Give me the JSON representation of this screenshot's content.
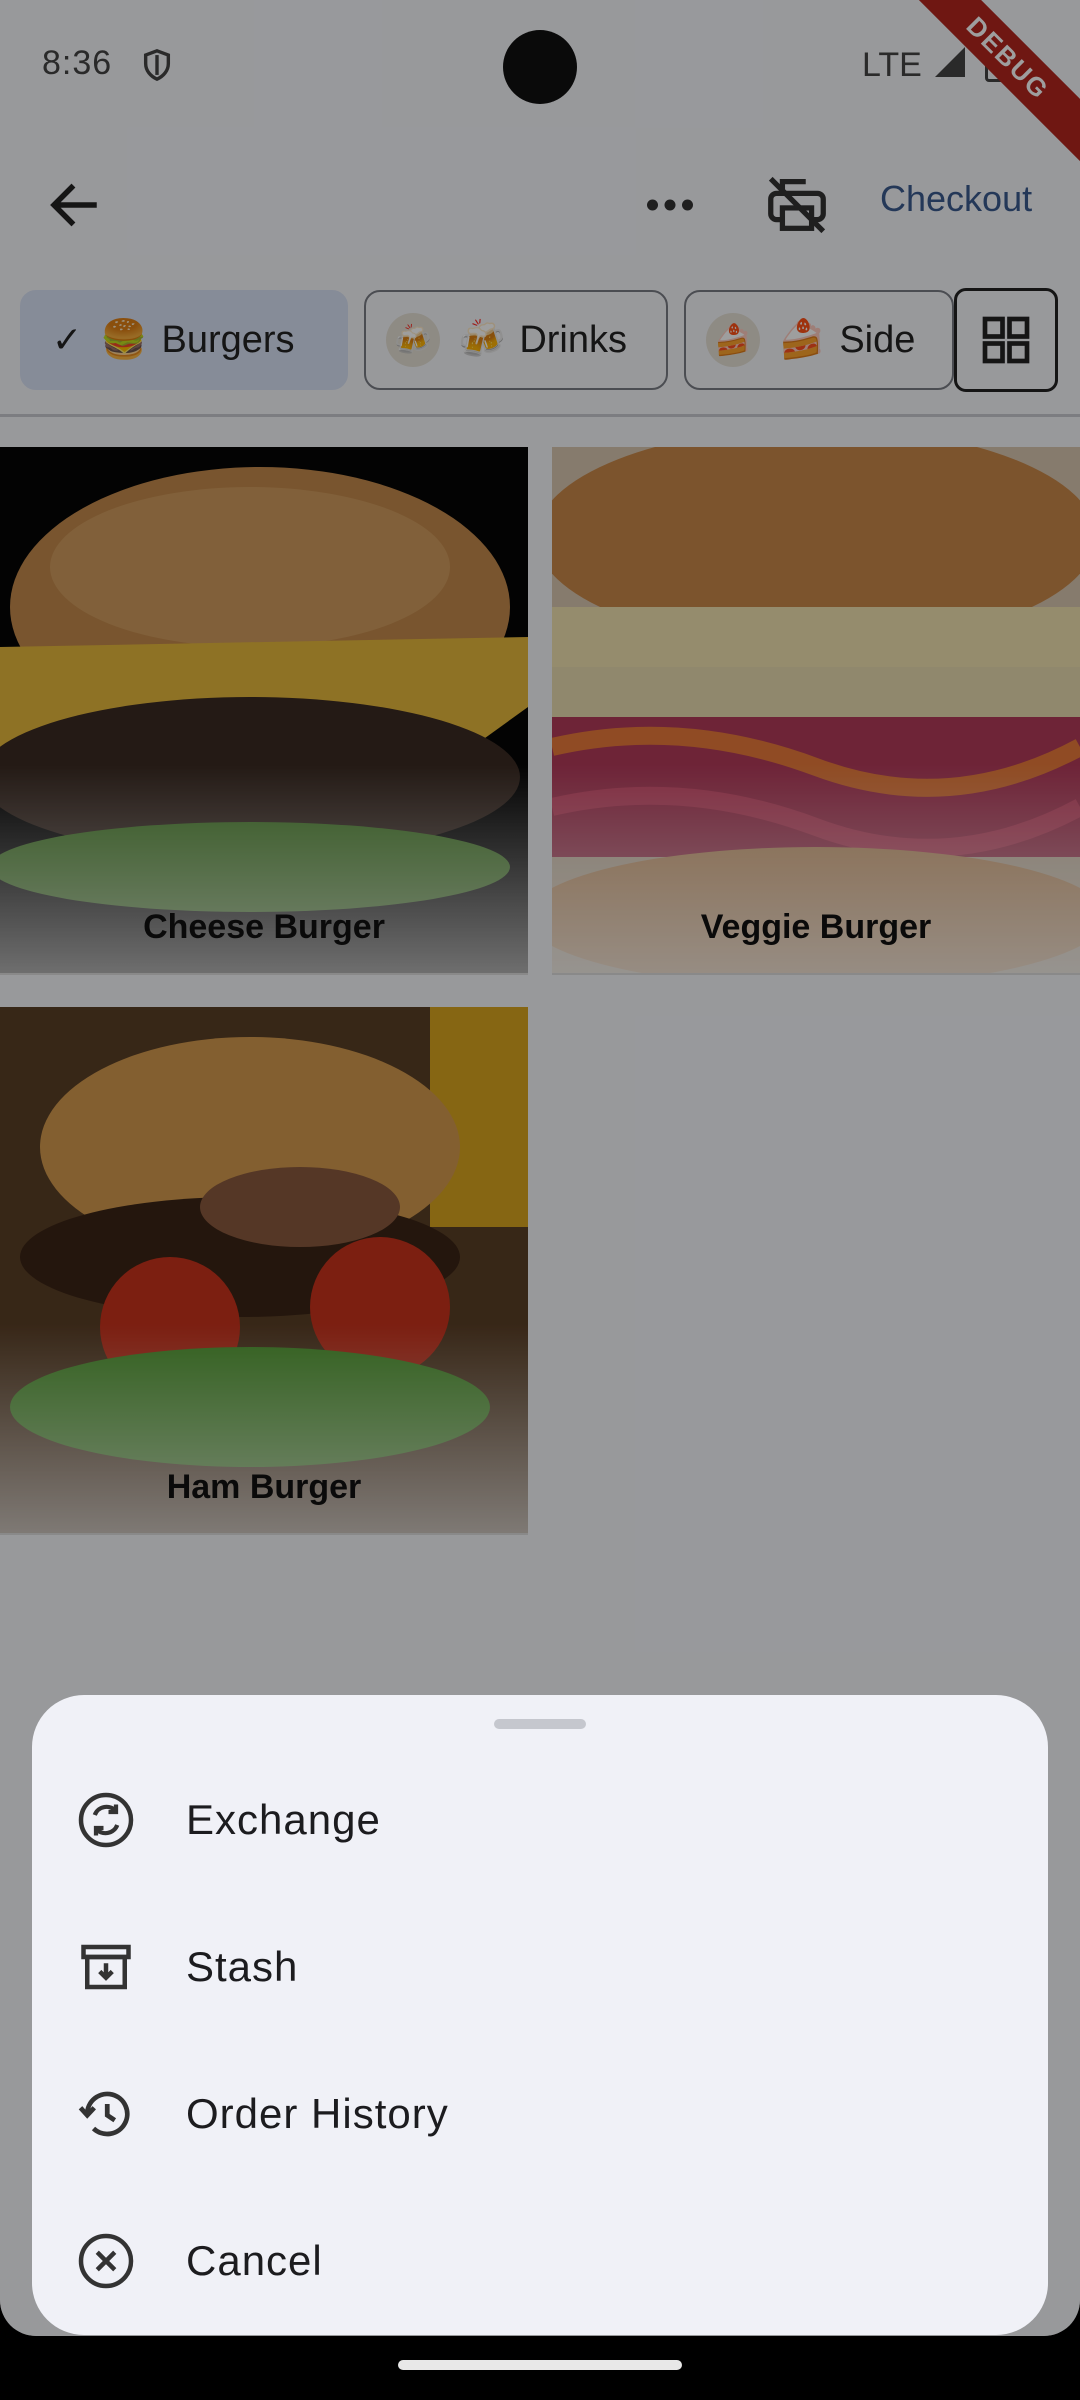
{
  "status_bar": {
    "time": "8:36",
    "network": "LTE",
    "debug_banner": "DEBUG"
  },
  "app_bar": {
    "checkout_label": "Checkout"
  },
  "categories": [
    {
      "label": "Burgers",
      "emoji": "🍔",
      "selected": true
    },
    {
      "label": "Drinks",
      "emoji": "🍻",
      "selected": false
    },
    {
      "label": "Side",
      "emoji": "🍰",
      "selected": false
    }
  ],
  "products": [
    {
      "name": "Cheese Burger"
    },
    {
      "name": "Veggie Burger"
    },
    {
      "name": "Ham Burger"
    }
  ],
  "bottom_sheet": {
    "items": [
      {
        "label": "Exchange",
        "icon": "exchange-icon"
      },
      {
        "label": "Stash",
        "icon": "archive-icon"
      },
      {
        "label": "Order History",
        "icon": "history-icon"
      },
      {
        "label": "Cancel",
        "icon": "cancel-icon"
      }
    ]
  },
  "colors": {
    "accent": "#3b5b8f",
    "chip_selected": "#d9e2f5",
    "sheet_bg": "#f0f1f7"
  }
}
